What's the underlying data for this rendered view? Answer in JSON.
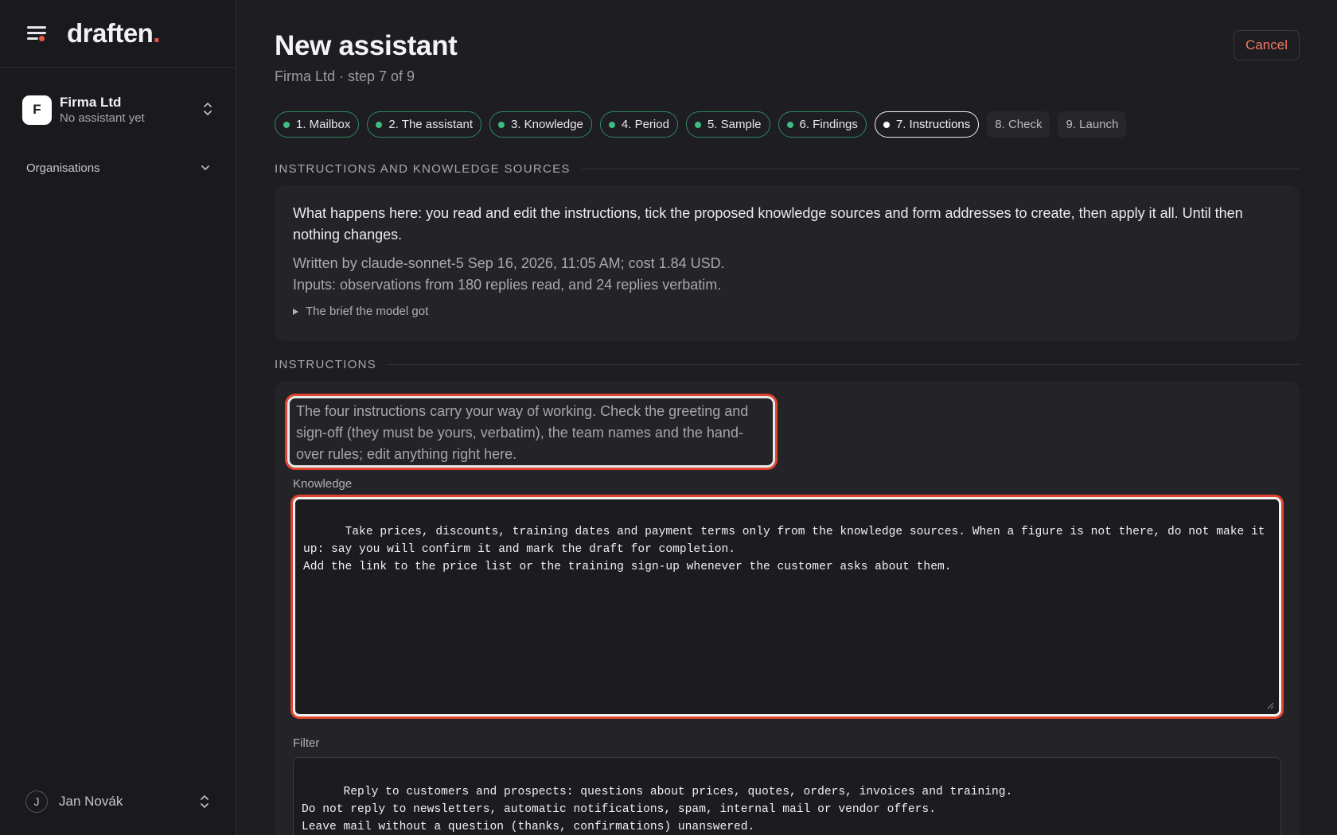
{
  "brand": {
    "name": "draften",
    "dot": "."
  },
  "sidebar": {
    "org": {
      "initial": "F",
      "name": "Firma Ltd",
      "subtitle": "No assistant yet"
    },
    "orgs_label": "Organisations",
    "user": {
      "initial": "J",
      "name": "Jan Novák"
    }
  },
  "header": {
    "title": "New assistant",
    "subtitle": "Firma Ltd · step 7 of 9",
    "cancel_label": "Cancel"
  },
  "steps": [
    {
      "label": "1. Mailbox",
      "state": "done"
    },
    {
      "label": "2. The assistant",
      "state": "done"
    },
    {
      "label": "3. Knowledge",
      "state": "done"
    },
    {
      "label": "4. Period",
      "state": "done"
    },
    {
      "label": "5. Sample",
      "state": "done"
    },
    {
      "label": "6. Findings",
      "state": "done"
    },
    {
      "label": "7. Instructions",
      "state": "current"
    },
    {
      "label": "8. Check",
      "state": "todo"
    },
    {
      "label": "9. Launch",
      "state": "todo"
    }
  ],
  "sources_section": {
    "title": "INSTRUCTIONS AND KNOWLEDGE SOURCES",
    "lead": "What happens here: you read and edit the instructions, tick the proposed knowledge sources and form addresses to create, then apply it all. Until then nothing changes.",
    "written_by": "Written by claude-sonnet-5 Sep 16, 2026, 11:05 AM; cost 1.84 USD.",
    "inputs": "Inputs: observations from 180 replies read, and 24 replies verbatim.",
    "brief_toggle": "The brief the model got"
  },
  "instructions_section": {
    "title": "INSTRUCTIONS",
    "note": "The four instructions carry your way of working. Check the greeting and sign-off (they must be yours, verbatim), the team names and the hand-over rules; edit anything right here.",
    "knowledge_label": "Knowledge",
    "knowledge_value": "Take prices, discounts, training dates and payment terms only from the knowledge sources. When a figure is not there, do not make it up: say you will confirm it and mark the draft for completion.\nAdd the link to the price list or the training sign-up whenever the customer asks about them.",
    "filter_label": "Filter",
    "filter_value": "Reply to customers and prospects: questions about prices, quotes, orders, invoices and training.\nDo not reply to newsletters, automatic notifications, spam, internal mail or vendor offers.\nLeave mail without a question (thanks, confirmations) unanswered."
  },
  "colors": {
    "accent": "#f0553d",
    "done_dot": "#3fbd7f",
    "highlight_ring": "#e0432e",
    "background": "#1d1d22"
  },
  "icons": [
    "menu-icon",
    "chevron-up-down-icon",
    "chevron-down-icon",
    "triangle-right-icon",
    "resize-grip-icon"
  ]
}
